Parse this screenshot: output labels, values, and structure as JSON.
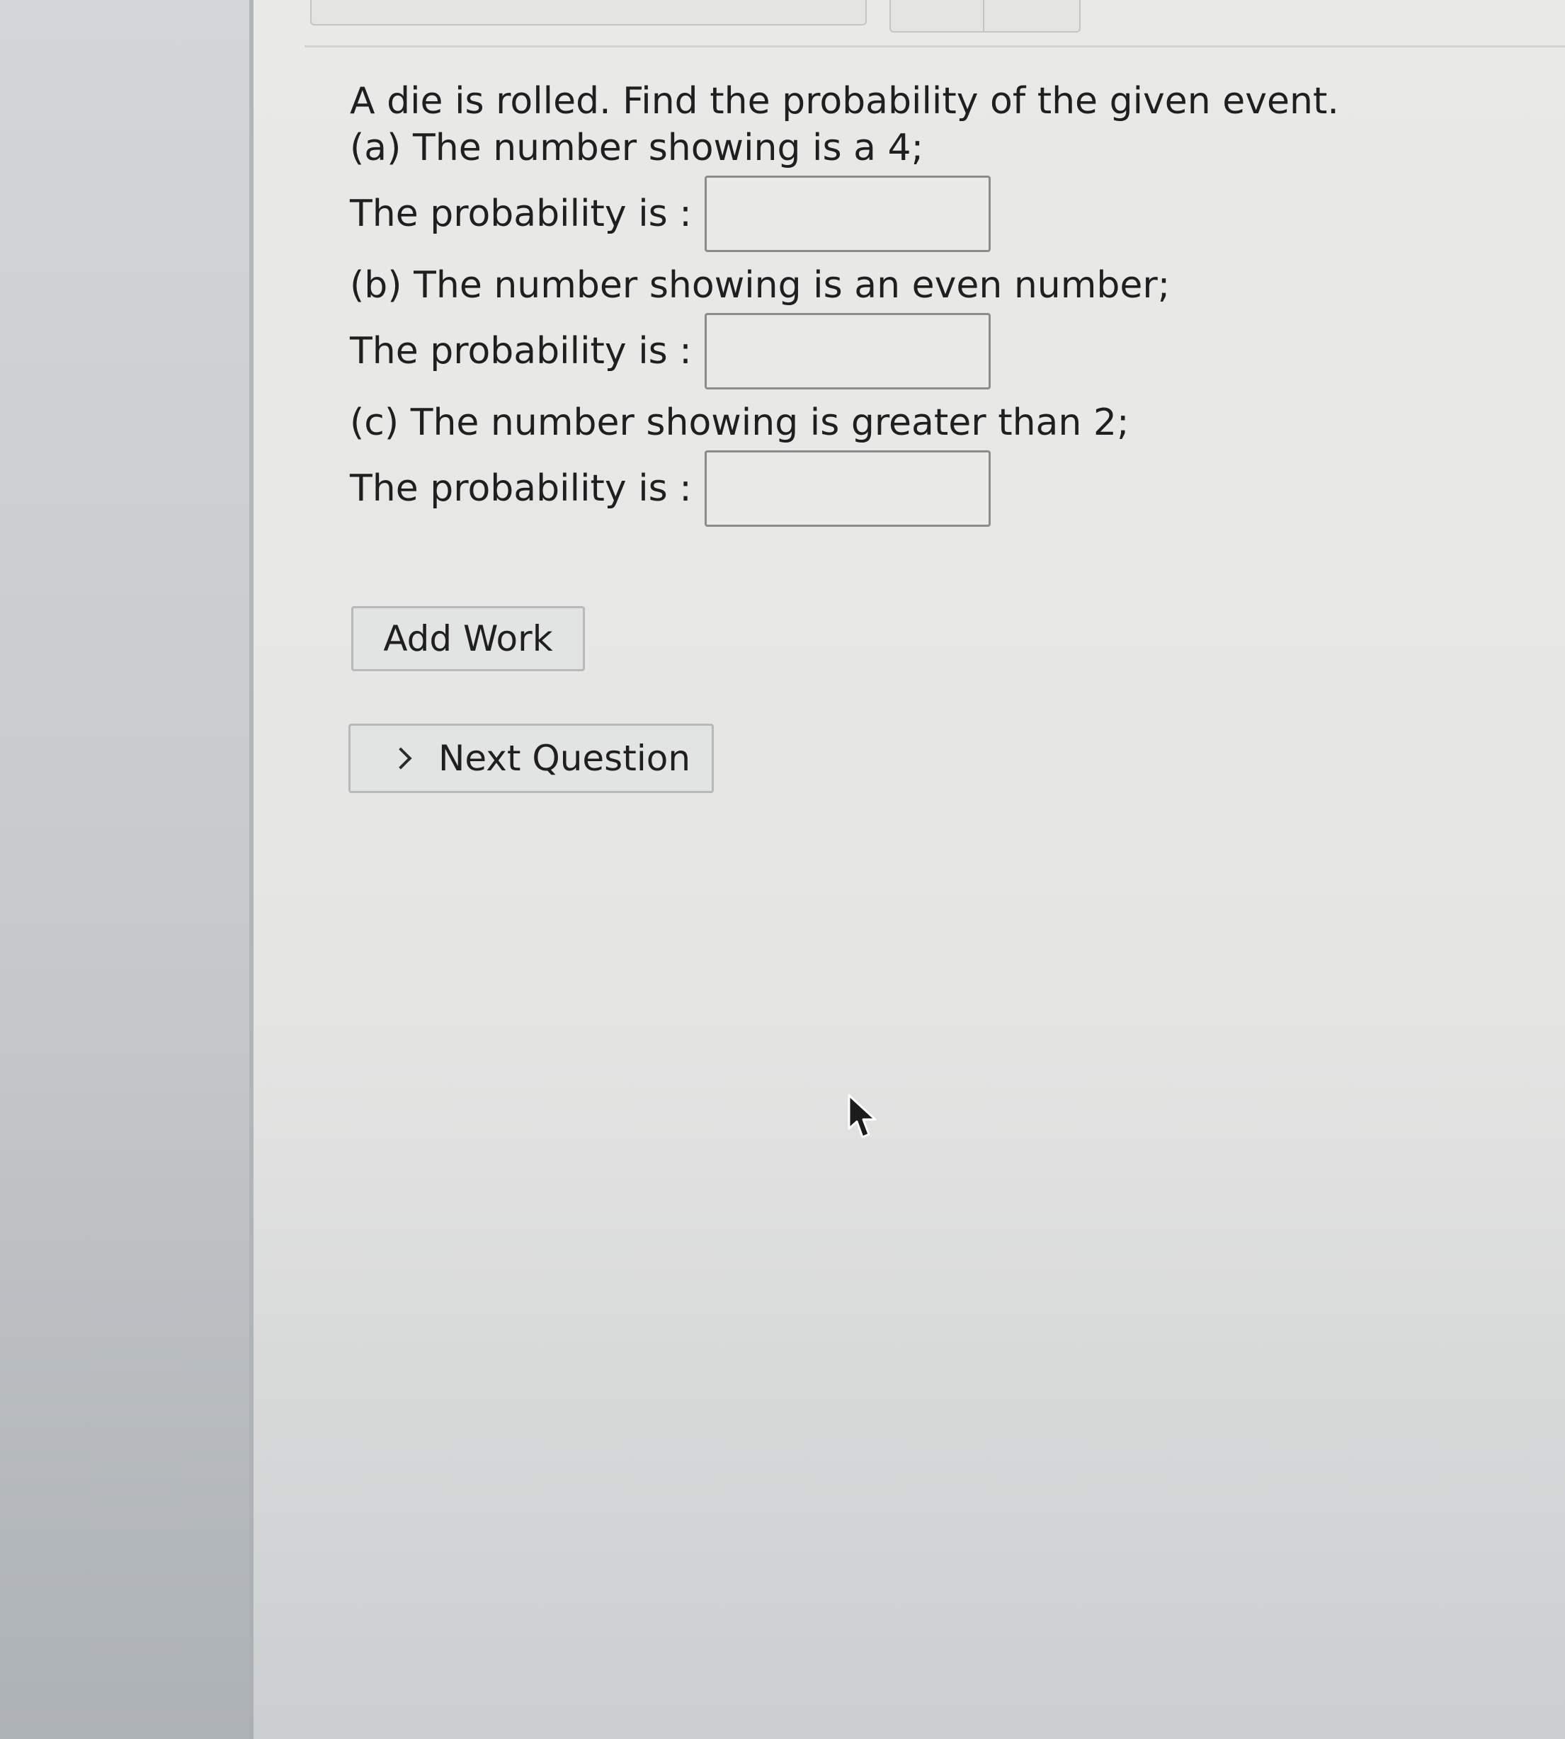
{
  "question": {
    "prompt": "A die is rolled. Find the probability of the given event.",
    "parts": [
      {
        "text": "(a) The number showing is a 4;",
        "answer_label": "The probability is :",
        "answer_value": ""
      },
      {
        "text": "(b) The number showing is an even number;",
        "answer_label": "The probability is :",
        "answer_value": ""
      },
      {
        "text": "(c) The number showing is greater than 2;",
        "answer_label": "The probability is :",
        "answer_value": ""
      }
    ]
  },
  "actions": {
    "add_work_label": "Add Work",
    "next_question_label": "Next Question",
    "next_question_icon": "chevron-right-icon"
  },
  "cursor": {
    "icon": "mouse-pointer-icon"
  }
}
